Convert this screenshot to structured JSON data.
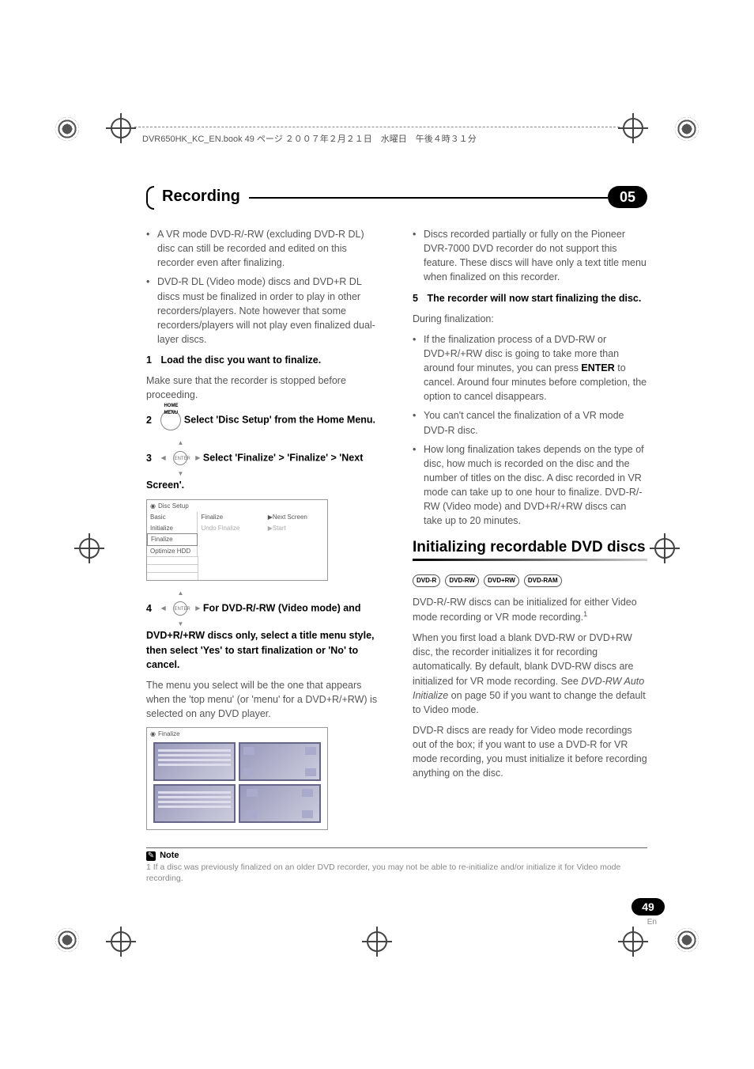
{
  "header_text": "DVR650HK_KC_EN.book  49 ページ  ２００７年２月２１日　水曜日　午後４時３１分",
  "tab": {
    "title": "Recording",
    "number": "05"
  },
  "left": {
    "bullets1": [
      "A VR mode DVD-R/-RW (excluding DVD-R DL) disc can still be recorded and edited on this recorder even after finalizing.",
      "DVD-R DL (Video mode) discs and DVD+R DL discs must be finalized in order to play in other recorders/players. Note however that some recorders/players will not play even finalized dual-layer discs."
    ],
    "step1_num": "1",
    "step1_bold": "Load the disc you want to finalize.",
    "step1_text": "Make sure that the recorder is stopped before proceeding.",
    "step2_num": "2",
    "step2_icon_label": "HOME MENU",
    "step2_bold": "Select 'Disc Setup' from the Home Menu.",
    "step3_num": "3",
    "enter_label": "ENTER",
    "step3_bold": "Select 'Finalize' > 'Finalize' > 'Next Screen'.",
    "disc_setup": {
      "title": "Disc Setup",
      "col1": [
        "Basic",
        "Initialize",
        "Finalize",
        "Optimize HDD"
      ],
      "col2": [
        "Finalize",
        "Undo Finalize"
      ],
      "col3": [
        "Next Screen",
        "Start"
      ]
    },
    "step4_num": "4",
    "step4_bold": "For DVD-R/-RW (Video mode) and DVD+R/+RW discs only, select a title menu style, then select 'Yes' to start finalization or 'No' to cancel.",
    "step4_text": "The menu you select will be the one that appears when the 'top menu' (or 'menu' for a DVD+R/+RW) is selected on any DVD player.",
    "finalize_title": "Finalize"
  },
  "right": {
    "bullets1": [
      "Discs recorded partially or fully on the Pioneer DVR-7000 DVD recorder do not support this feature. These discs will have only a text title menu when finalized on this recorder."
    ],
    "step5_num": "5",
    "step5_bold": "The recorder will now start finalizing the disc.",
    "step5_text": "During finalization:",
    "bullets2_a_pre": "If the finalization process of a DVD-RW or DVD+R/+RW disc is going to take more than around four minutes, you can press ",
    "bullets2_a_key": "ENTER",
    "bullets2_a_post": " to cancel. Around four minutes before completion, the option to cancel disappears.",
    "bullets2_b": "You can't cancel the finalization of a VR mode DVD-R disc.",
    "bullets2_c": "How long finalization takes depends on the type of disc, how much is recorded on the disc and the number of titles on the disc. A disc recorded in VR mode can take up to one hour to finalize. DVD-R/-RW (Video mode) and DVD+R/+RW discs can take up to 20 minutes.",
    "h2": "Initializing recordable DVD discs",
    "badges": [
      "DVD-R",
      "DVD-RW",
      "DVD+RW",
      "DVD-RAM"
    ],
    "p1_pre": "DVD-R/-RW discs can be initialized for either Video mode recording or VR mode recording.",
    "p1_sup": "1",
    "p2_a": "When you first load a blank DVD-RW or DVD+RW disc, the recorder initializes it for recording automatically. By default, blank DVD-RW discs are initialized for VR mode recording. See ",
    "p2_i": "DVD-RW Auto Initialize",
    "p2_b": " on page 50 if you want to change the default to Video mode.",
    "p3": "DVD-R discs are ready for Video mode recordings out of the box; if you want to use a DVD-R for VR mode recording, you must initialize it before recording anything on the disc."
  },
  "note": {
    "label": "Note",
    "text": "1 If a disc was previously finalized on an older DVD recorder, you may not be able to re-initialize and/or initialize it for Video mode recording."
  },
  "page": {
    "number": "49",
    "lang": "En"
  }
}
